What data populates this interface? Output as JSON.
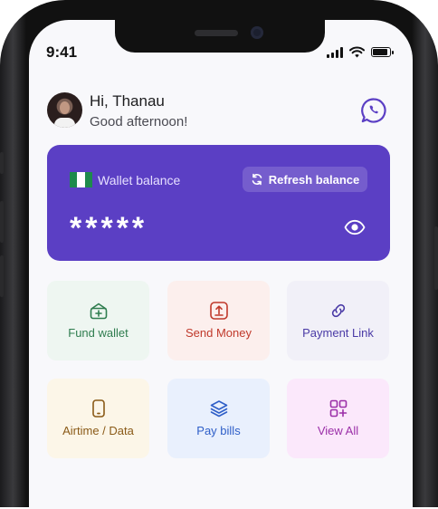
{
  "status_bar": {
    "time": "9:41"
  },
  "header": {
    "greeting": "Hi, Thanau",
    "subtitle": "Good afternoon!"
  },
  "wallet": {
    "label": "Wallet balance",
    "refresh_label": "Refresh balance",
    "masked_balance": "*****"
  },
  "actions": [
    {
      "label": "Fund wallet",
      "icon": "wallet-add-icon",
      "bg": "#eef6f1",
      "color": "#2f7d4f"
    },
    {
      "label": "Send Money",
      "icon": "upload-icon",
      "bg": "#fcefed",
      "color": "#c0392b"
    },
    {
      "label": "Payment Link",
      "icon": "link-icon",
      "bg": "#f1f0f8",
      "color": "#4a3aa6"
    },
    {
      "label": "Airtime / Data",
      "icon": "phone-icon",
      "bg": "#fcf6e8",
      "color": "#8a5a17"
    },
    {
      "label": "Pay bills",
      "icon": "layers-icon",
      "bg": "#e9f0fd",
      "color": "#2f5fc8"
    },
    {
      "label": "View All",
      "icon": "grid-add-icon",
      "bg": "#fbe8fb",
      "color": "#9b2fa8"
    }
  ],
  "colors": {
    "card": "#5b3fc4",
    "whatsapp": "#5b3fc4"
  }
}
